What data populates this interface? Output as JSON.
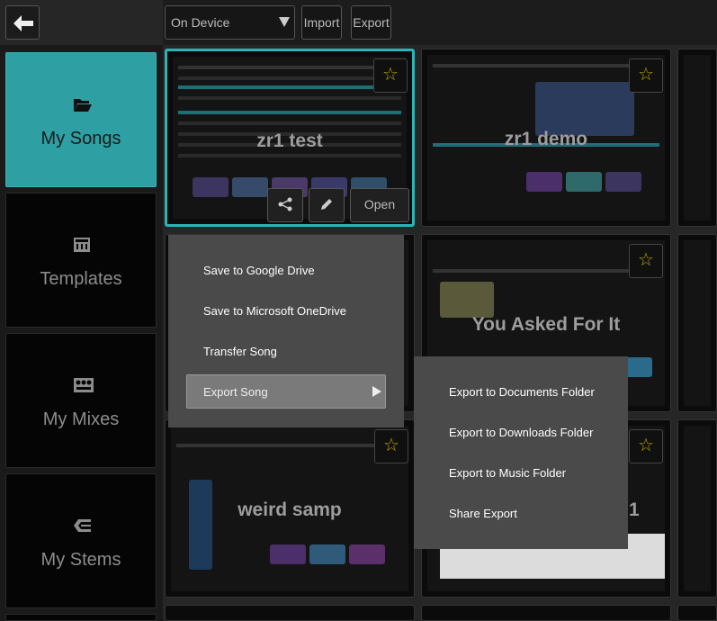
{
  "toolbar": {
    "location_select": "On Device",
    "import_label": "Import",
    "export_label": "Export"
  },
  "sidebar": {
    "items": [
      {
        "label": "My Songs",
        "icon": "folder-open-icon",
        "active": true
      },
      {
        "label": "Templates",
        "icon": "keyboard-icon",
        "active": false
      },
      {
        "label": "My Mixes",
        "icon": "mixer-icon",
        "active": false
      },
      {
        "label": "My Stems",
        "icon": "stems-icon",
        "active": false
      }
    ]
  },
  "songs": [
    {
      "title": "zr1 test"
    },
    {
      "title": "zr1 demo"
    },
    {
      "title": "You Asked For It"
    },
    {
      "title": "weird samp"
    },
    {
      "title": "1"
    }
  ],
  "selected_card": {
    "open_label": "Open",
    "share_icon": "share-icon",
    "edit_icon": "pencil-icon"
  },
  "share_menu": {
    "items": [
      "Save to Google Drive",
      "Save to Microsoft OneDrive",
      "Transfer Song",
      "Export Song"
    ]
  },
  "export_menu": {
    "items": [
      "Export to Documents Folder",
      "Export to Downloads Folder",
      "Export to Music Folder",
      "Share Export"
    ]
  },
  "colors": {
    "accent": "#2e9fa3",
    "star": "#b8a800",
    "menu_bg": "#4a4a4a"
  }
}
